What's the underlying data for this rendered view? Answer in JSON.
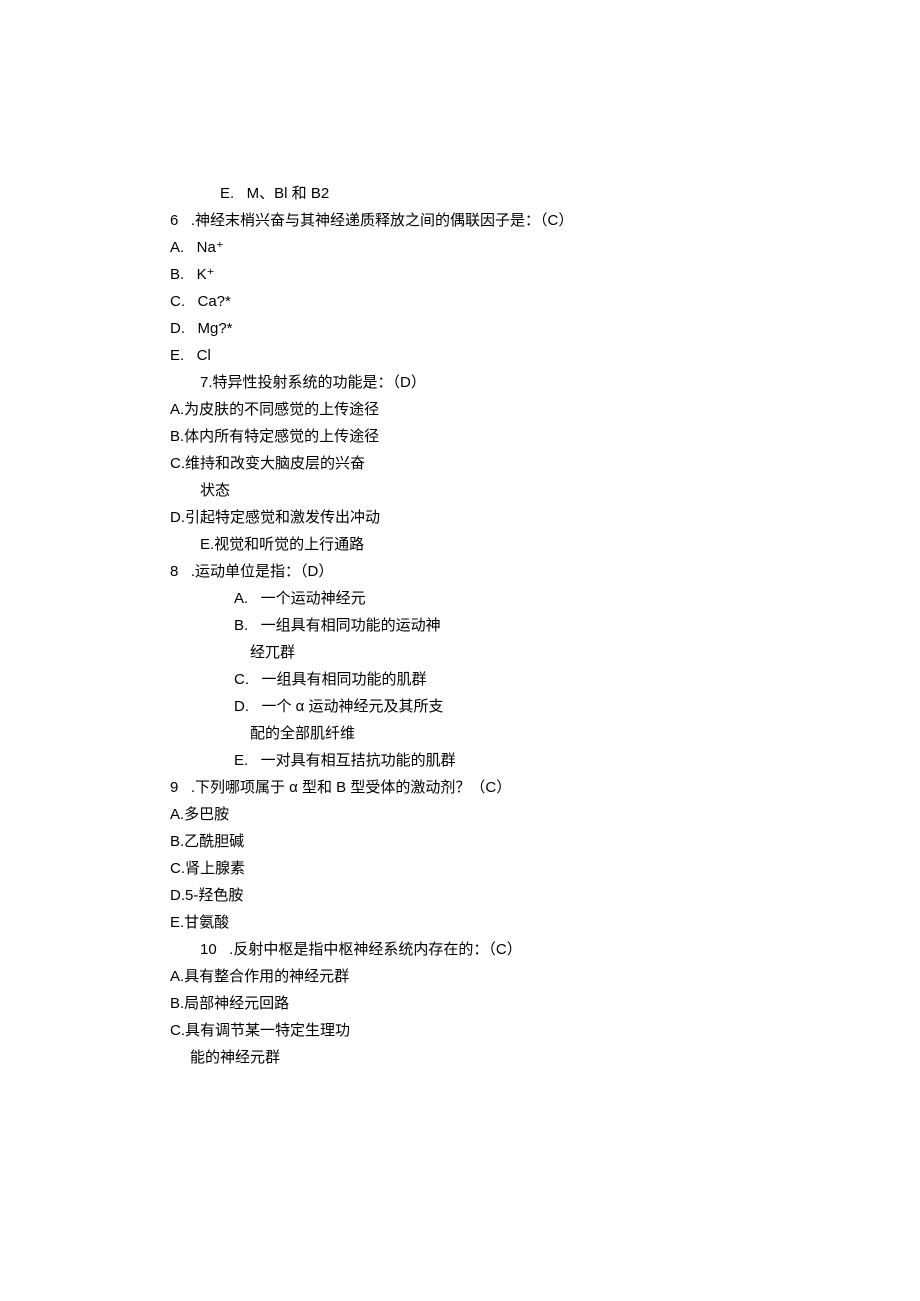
{
  "lines": [
    {
      "cls": "indent1",
      "text": "E.   M、Bl 和 B2"
    },
    {
      "cls": "",
      "text": "6   .神经末梢兴奋与其神经递质释放之间的偶联因子是：（C）"
    },
    {
      "cls": "",
      "text": "A.   Na⁺"
    },
    {
      "cls": "",
      "text": "B.   K⁺"
    },
    {
      "cls": "",
      "text": "C.   Ca?*"
    },
    {
      "cls": "",
      "text": "D.   Mg?*"
    },
    {
      "cls": "",
      "text": "E.   Cl"
    },
    {
      "cls": "indent2",
      "text": "7.特异性投射系统的功能是：（D）"
    },
    {
      "cls": "",
      "text": "A.为皮肤的不同感觉的上传途径"
    },
    {
      "cls": "",
      "text": "B.体内所有特定感觉的上传途径"
    },
    {
      "cls": "",
      "text": "C.维持和改变大脑皮层的兴奋"
    },
    {
      "cls": "indent2",
      "text": "状态"
    },
    {
      "cls": "",
      "text": "D.引起特定感觉和激发传出冲动"
    },
    {
      "cls": "indent2",
      "text": "E.视觉和听觉的上行通路"
    },
    {
      "cls": "",
      "text": "8   .运动单位是指：（D）"
    },
    {
      "cls": "indent3",
      "text": "A.   一个运动神经元"
    },
    {
      "cls": "indent3",
      "text": "B.   一组具有相同功能的运动神"
    },
    {
      "cls": "indent4",
      "text": "经兀群"
    },
    {
      "cls": "indent3",
      "text": "C.   一组具有相同功能的肌群"
    },
    {
      "cls": "indent3",
      "text": "D.   一个 α 运动神经元及其所支"
    },
    {
      "cls": "indent4",
      "text": "配的全部肌纤维"
    },
    {
      "cls": "indent3",
      "text": "E.   一对具有相互拮抗功能的肌群"
    },
    {
      "cls": "",
      "text": "9   .下列哪项属于 α 型和 B 型受体的激动剂？（C）"
    },
    {
      "cls": "",
      "text": "A.多巴胺"
    },
    {
      "cls": "",
      "text": "B.乙酰胆碱"
    },
    {
      "cls": "",
      "text": "C.肾上腺素"
    },
    {
      "cls": "",
      "text": "D.5-羟色胺"
    },
    {
      "cls": "",
      "text": "E.甘氨酸"
    },
    {
      "cls": "indent2",
      "text": "10   .反射中枢是指中枢神经系统内存在的：（C）"
    },
    {
      "cls": "",
      "text": "A.具有整合作用的神经元群"
    },
    {
      "cls": "",
      "text": "B.局部神经元回路"
    },
    {
      "cls": "",
      "text": "C.具有调节某一特定生理功"
    },
    {
      "cls": "indent5",
      "text": "能的神经元群"
    }
  ]
}
